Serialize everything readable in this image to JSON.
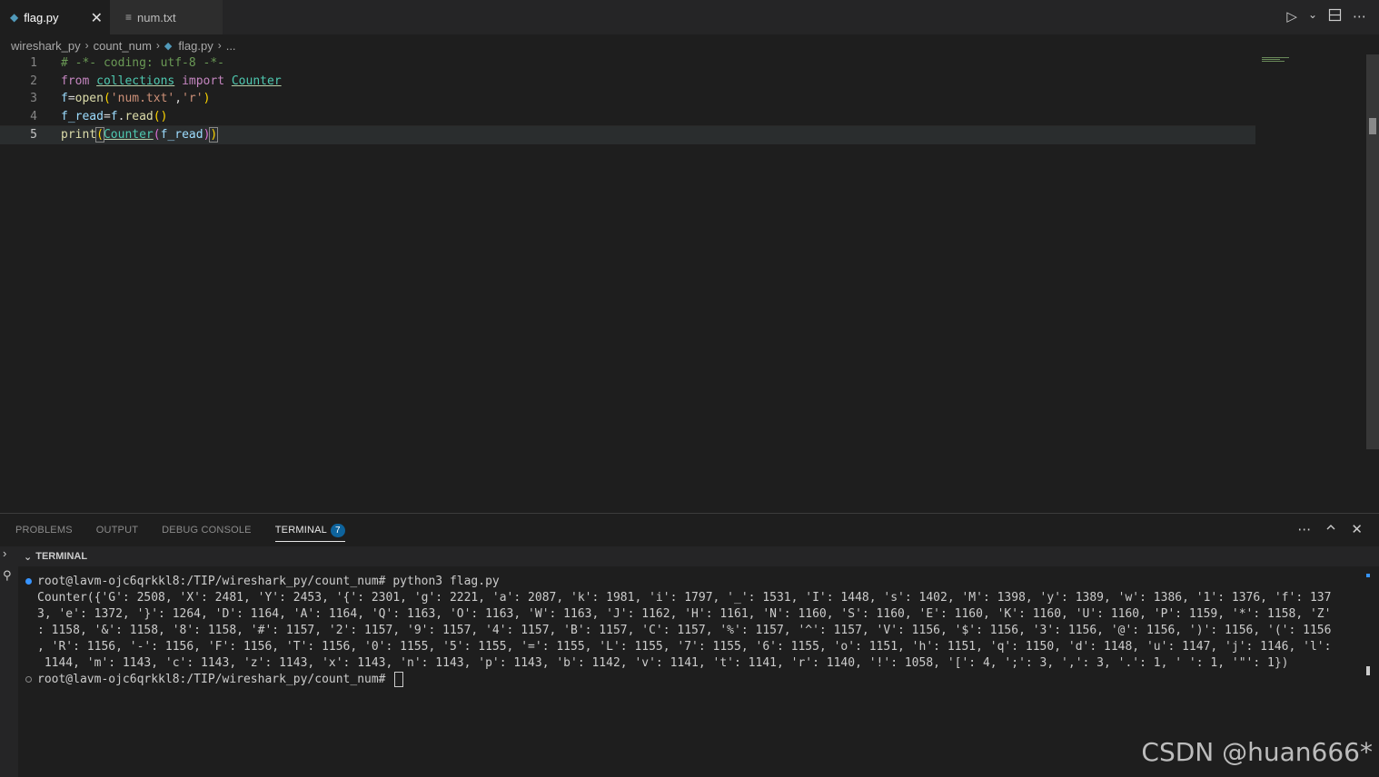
{
  "tabs": [
    {
      "label": "flag.py",
      "icon": "python-icon",
      "active": true
    },
    {
      "label": "num.txt",
      "icon": "lines-icon",
      "active": false
    }
  ],
  "toolbar": {
    "run_icon": "▷",
    "chevron_icon": "⌄",
    "split_icon": "split-editor-icon",
    "more_icon": "⋯"
  },
  "breadcrumb": [
    "wireshark_py",
    "count_num",
    "flag.py",
    "..."
  ],
  "editor": {
    "lines": [
      {
        "num": "1"
      },
      {
        "num": "2"
      },
      {
        "num": "3"
      },
      {
        "num": "4"
      },
      {
        "num": "5"
      }
    ],
    "code": {
      "l1": "# -*- coding: utf-8 -*-",
      "l2_from": "from",
      "l2_mod": "collections",
      "l2_import": "import",
      "l2_cls": "Counter",
      "l3_var": "f",
      "l3_eq": "=",
      "l3_fn": "open",
      "l3_p1": "(",
      "l3_s1": "'num.txt'",
      "l3_c": ",",
      "l3_s2": "'r'",
      "l3_p2": ")",
      "l4_var": "f_read",
      "l4_eq": "=",
      "l4_var2": "f",
      "l4_dot": ".",
      "l4_fn": "read",
      "l4_par": "()",
      "l5_fn": "print",
      "l5_p1": "(",
      "l5_cls": "Counter",
      "l5_p2": "(",
      "l5_var": "f_read",
      "l5_p3": ")",
      "l5_p4": ")"
    }
  },
  "panel": {
    "tabs": [
      "PROBLEMS",
      "OUTPUT",
      "DEBUG CONSOLE",
      "TERMINAL"
    ],
    "badge": "7",
    "section_title": "TERMINAL"
  },
  "terminal": {
    "lines": [
      "root@lavm-ojc6qrkkl8:/TIP/wireshark_py/count_num# python3 flag.py",
      "Counter({'G': 2508, 'X': 2481, 'Y': 2453, '{': 2301, 'g': 2221, 'a': 2087, 'k': 1981, 'i': 1797, '_': 1531, 'I': 1448, 's': 1402, 'M': 1398, 'y': 1389, 'w': 1386, '1': 1376, 'f': 137",
      "3, 'e': 1372, '}': 1264, 'D': 1164, 'A': 1164, 'Q': 1163, 'O': 1163, 'W': 1163, 'J': 1162, 'H': 1161, 'N': 1160, 'S': 1160, 'E': 1160, 'K': 1160, 'U': 1160, 'P': 1159, '*': 1158, 'Z'",
      ": 1158, '&': 1158, '8': 1158, '#': 1157, '2': 1157, '9': 1157, '4': 1157, 'B': 1157, 'C': 1157, '%': 1157, '^': 1157, 'V': 1156, '$': 1156, '3': 1156, '@': 1156, ')': 1156, '(': 1156",
      ", 'R': 1156, '-': 1156, 'F': 1156, 'T': 1156, '0': 1155, '5': 1155, '=': 1155, 'L': 1155, '7': 1155, '6': 1155, 'o': 1151, 'h': 1151, 'q': 1150, 'd': 1148, 'u': 1147, 'j': 1146, 'l':",
      " 1144, 'm': 1143, 'c': 1143, 'z': 1143, 'x': 1143, 'n': 1143, 'p': 1143, 'b': 1142, 'v': 1141, 't': 1141, 'r': 1140, '!': 1058, '[': 4, ';': 3, ',': 3, '.': 1, ' ': 1, '\"': 1})",
      "root@lavm-ojc6qrkkl8:/TIP/wireshark_py/count_num# "
    ]
  },
  "watermark": "CSDN @huan666*"
}
